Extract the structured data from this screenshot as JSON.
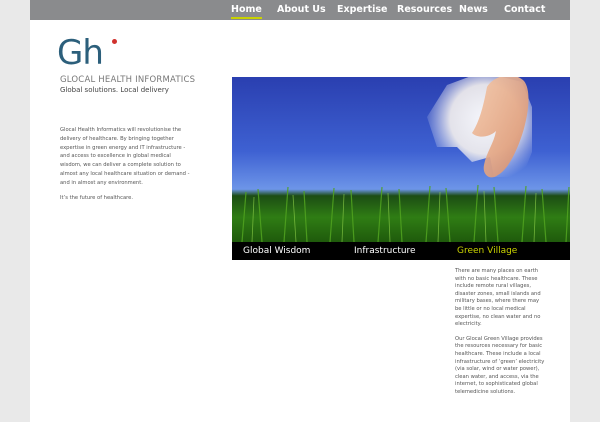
{
  "nav": {
    "items": [
      {
        "label": "Home",
        "active": true
      },
      {
        "label": "About Us",
        "active": false
      },
      {
        "label": "Expertise",
        "active": false
      },
      {
        "label": "Resources",
        "active": false
      },
      {
        "label": "News",
        "active": false
      },
      {
        "label": "Contact",
        "active": false
      }
    ]
  },
  "brand": {
    "logo_text": "Gh",
    "name": "GLOCAL HEALTH INFORMATICS",
    "tagline": "Global solutions. Local delivery"
  },
  "intro": {
    "paragraphs": [
      "Glocal Health Informatics will revolutionise the delivery of healthcare. By bringing together expertise in green energy and IT infrastructure - and access to excellence in global medical wisdom, we can deliver a complete solution to almost any local healthcare situation or demand - and in almost any environment.",
      "It’s the future of healthcare."
    ]
  },
  "tabs": [
    {
      "label": "Global Wisdom",
      "active": false
    },
    {
      "label": "Infrastructure",
      "active": false
    },
    {
      "label": "Green Village",
      "active": true
    }
  ],
  "description": {
    "paragraphs": [
      "There are many places on earth with no basic healthcare. These include remote rural villages, disaster zones, small islands and military bases, where there may be little or no local medical expertise, no clean water and no electricity.",
      "Our Glocal Green Village provides the resources necessary for basic healthcare. These include a local infrastructure of ‘green’ electricity (via solar, wind or water power), clean water, and access, via the internet, to sophisticated global telemedicine solutions."
    ]
  },
  "colors": {
    "nav_bg": "#8a8b8d",
    "accent": "#c9d200",
    "logo": "#2c5f7b",
    "logo_dot": "#d0312d",
    "tab_bar_bg": "#000000"
  }
}
